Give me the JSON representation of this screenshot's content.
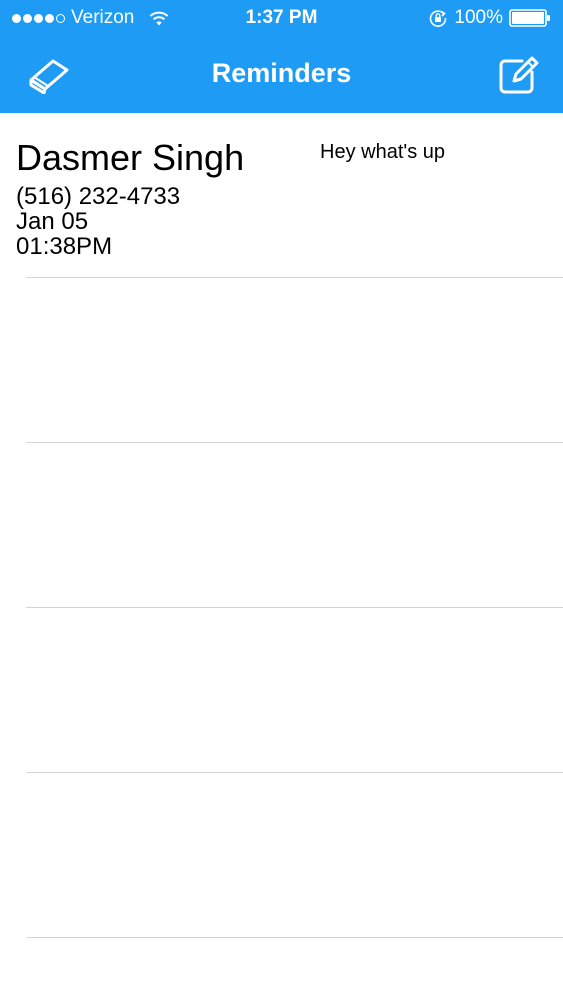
{
  "status_bar": {
    "carrier": "Verizon",
    "time": "1:37 PM",
    "battery": "100%"
  },
  "nav": {
    "title": "Reminders",
    "left_icon": "eraser-icon",
    "right_icon": "compose-icon"
  },
  "colors": {
    "header": "#1e9cf5",
    "separator": "#d4d4d4"
  },
  "reminders": [
    {
      "name": "Dasmer Singh",
      "phone": "(516) 232-4733",
      "date": "Jan 05",
      "time": "01:38PM",
      "message": "Hey what's up"
    }
  ]
}
